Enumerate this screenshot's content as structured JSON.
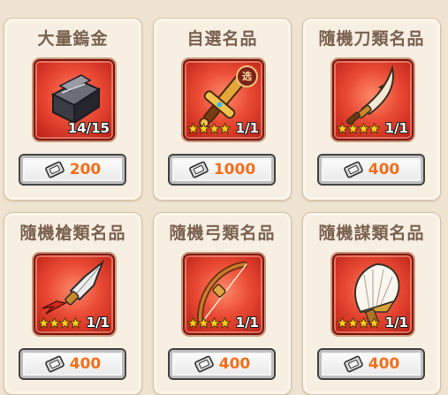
{
  "shop": {
    "items": [
      {
        "title": "大量鎢金",
        "qty": "14/15",
        "price": "200",
        "icon": "tungsten-ingot-icon"
      },
      {
        "title": "自選名品",
        "badge": "选",
        "qty": "1/1",
        "price": "1000",
        "icon": "golden-handle-icon"
      },
      {
        "title": "隨機刀類名品",
        "qty": "1/1",
        "price": "400",
        "icon": "saber-blade-icon"
      },
      {
        "title": "隨機槍類名品",
        "qty": "1/1",
        "price": "400",
        "icon": "spear-head-icon"
      },
      {
        "title": "隨機弓類名品",
        "qty": "1/1",
        "price": "400",
        "icon": "bow-icon"
      },
      {
        "title": "隨機謀類名品",
        "qty": "1/1",
        "price": "400",
        "icon": "feather-fan-icon"
      }
    ],
    "star_count": 4,
    "currency_icon": "ticket-currency-icon",
    "colors": {
      "price": "#f36f1c",
      "frame": "#ea4b35",
      "card_bg": "#f8efe3",
      "title": "#7a6150"
    }
  }
}
